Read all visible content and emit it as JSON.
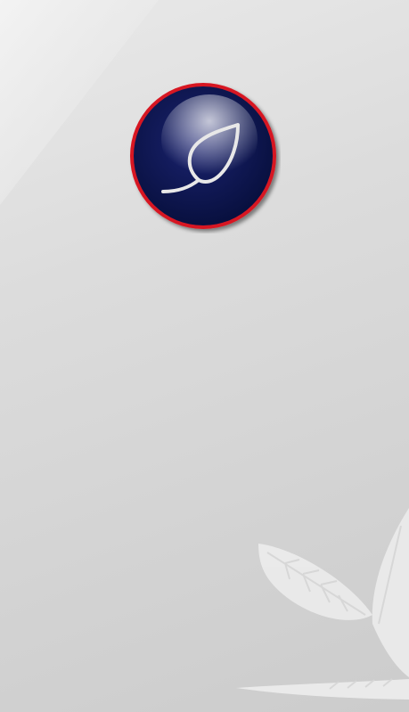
{
  "screen": {
    "name": "splash-screen",
    "background_color": "#d8d8d8"
  },
  "logo": {
    "icon": "leaf-icon",
    "badge_fill": "#0d1450",
    "ring_color": "#d71920",
    "leaf_stroke": "#e8e8e8"
  },
  "watermark": {
    "icon": "leaf-pattern-icon",
    "color": "#eeeeee"
  }
}
